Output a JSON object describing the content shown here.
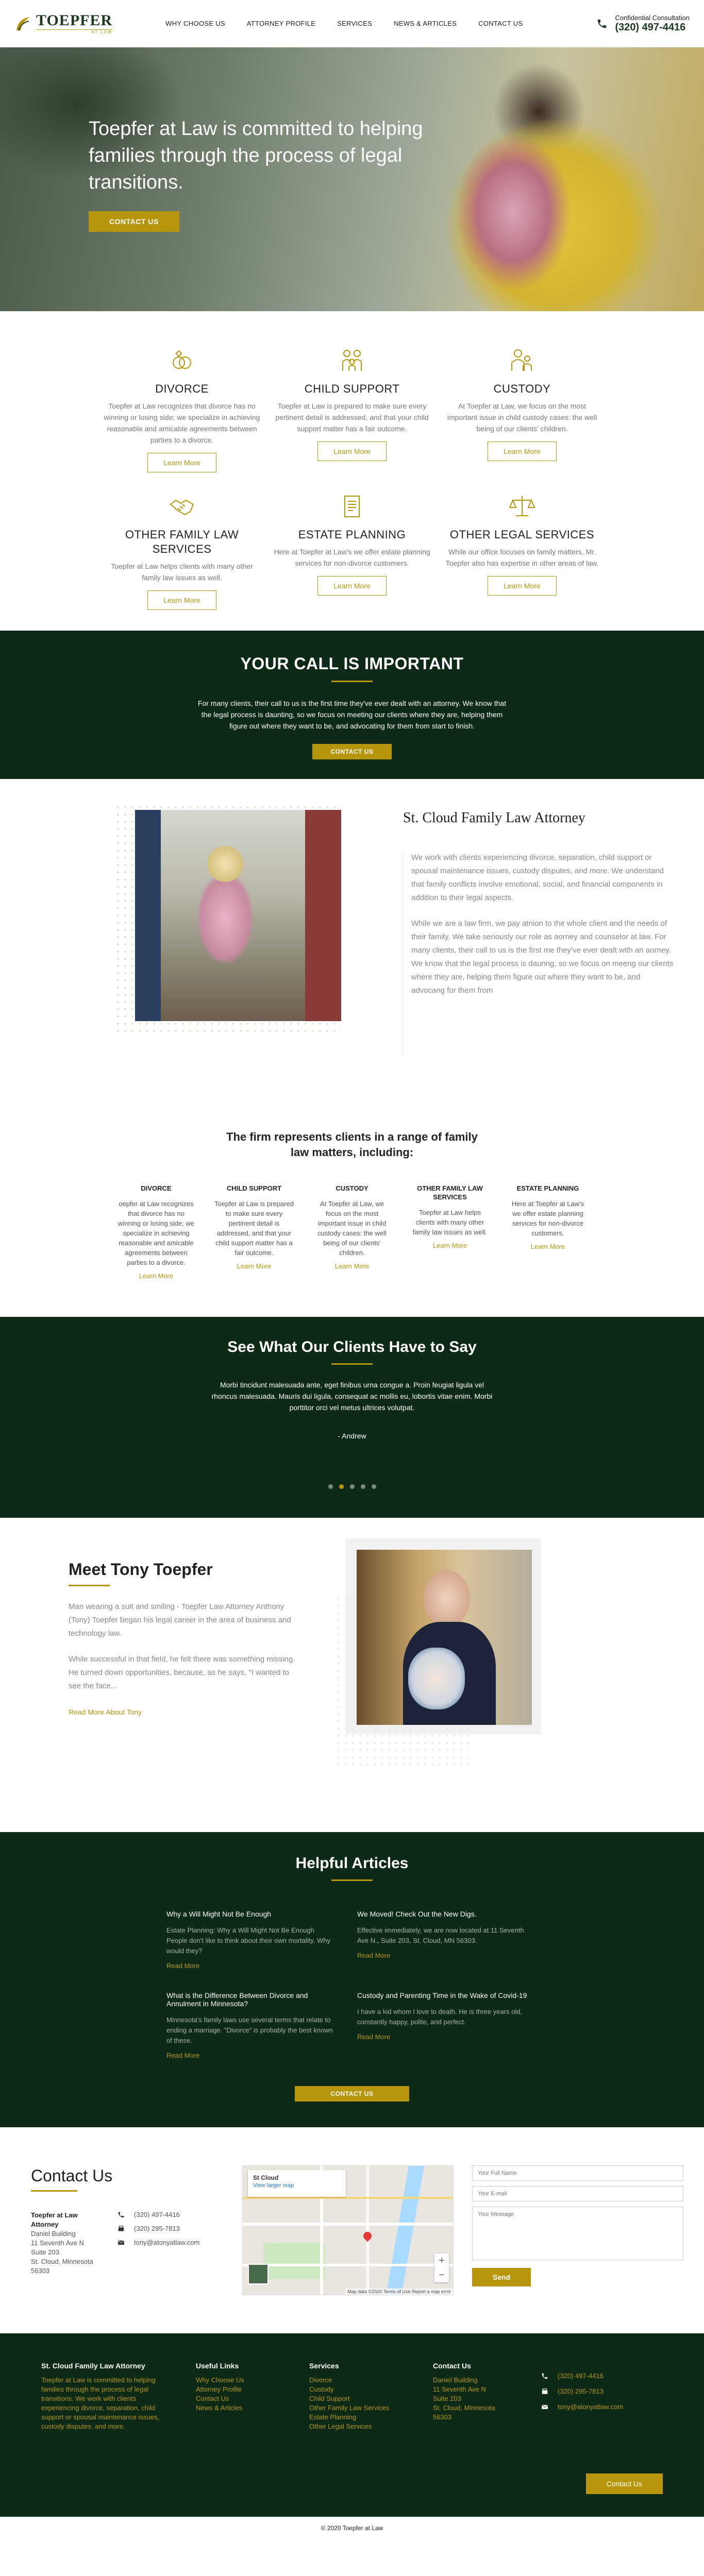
{
  "header": {
    "logo_title": "TOEPFER",
    "logo_sub": "AT LAW",
    "nav": [
      "WHY CHOOSE US",
      "ATTORNEY PROFILE",
      "SERVICES",
      "NEWS & ARTICLES",
      "CONTACT US"
    ],
    "consult_label": "Confidential Consultation",
    "consult_phone": "(320) 497-4416"
  },
  "hero": {
    "headline": "Toepfer at Law is committed to helping families through the process of legal transitions.",
    "cta": "CONTACT US"
  },
  "services": [
    {
      "title": "DIVORCE",
      "icon": "rings-icon",
      "text": "Toepfer at Law recognizes that divorce has no winning or losing side; we specialize in achieving reasonable and amicable agreements between parties to a divorce.",
      "link": "Learn More"
    },
    {
      "title": "CHILD SUPPORT",
      "icon": "family-icon",
      "text": "Toepfer at Law is prepared to make sure every pertinent detail is addressed, and that your child support matter has a fair outcome.",
      "link": "Learn More"
    },
    {
      "title": "CUSTODY",
      "icon": "parent-child-icon",
      "text": "At Toepfer at Law, we focus on the most important issue in child custody cases: the well being of our clients' children.",
      "link": "Learn More"
    },
    {
      "title": "OTHER FAMILY LAW SERVICES",
      "icon": "handshake-icon",
      "text": "Toepfer at Law helps clients with many other family law issues as well.",
      "link": "Learn More"
    },
    {
      "title": "ESTATE PLANNING",
      "icon": "document-icon",
      "text": "Here at Toepfer at Law's we offer estate planning services for non-divorce customers.",
      "link": "Learn More"
    },
    {
      "title": "OTHER LEGAL SERVICES",
      "icon": "scales-icon",
      "text": "While our office focuses on family matters, Mr. Toepfer also has expertise in other areas of law.",
      "link": "Learn More"
    }
  ],
  "call": {
    "title": "YOUR CALL IS IMPORTANT",
    "text": "For many clients, their call to us is the first time they've ever dealt with an attorney. We know that the legal process is daunting, so we focus on meeting our clients where they are, helping them figure out where they want to be, and advocating for them from start to finish.",
    "cta": "CONTACT US"
  },
  "about": {
    "title": "St. Cloud Family Law Attorney",
    "p1": "We work with clients experiencing divorce, separation, child support or spousal maintenance issues, custody disputes, and more. We understand that family conflicts involve emotional, social, and financial components in addition to their legal aspects.",
    "p2": "While we are a law firm, we pay atnion to the whole client and the needs of their family. We take seriously our role as aorney and counselor at law. For many clients, their call to us is the first me they've ever dealt with an aorney. We know that the legal process is daunng, so we focus on meeng our clients where they are, helping them figure out where they want to be, and advocang for them from"
  },
  "represent": {
    "title": "The firm represents clients in a range of family law matters, including:",
    "items": [
      {
        "title": "DIVORCE",
        "text": "oepfer at Law recognizes that divorce has no winning or losing side; we specialize in achieving reasonable and amicable agreements between parties to a divorce.",
        "link": "Learn More"
      },
      {
        "title": "CHILD SUPPORT",
        "text": "Toepfer at Law is prepared to make sure every pertinent detail is addressed, and that your child support matter has a fair outcome.",
        "link": "Learn More"
      },
      {
        "title": "CUSTODY",
        "text": "At Toepfer at Law, we focus on the most important issue in child custody cases: the well being of our clients' children.",
        "link": "Learn More"
      },
      {
        "title": "OTHER FAMILY LAW SERVICES",
        "text": "Toepfer at Law helps clients with many other family law issues as well.",
        "link": "Learn More"
      },
      {
        "title": "ESTATE PLANNING",
        "text": "Here at Toepfer at Law's we offer estate planning services for non-divorce customers.",
        "link": "Learn More"
      }
    ]
  },
  "testimonials": {
    "title": "See What Our Clients Have to Say",
    "quote": "Morbi tincidunt malesuada ante, eget finibus urna congue a. Proin feugiat ligula vel rhoncus malesuada. Mauris dui ligula, consequat ac mollis eu, lobortis vitae enim. Morbi porttitor orci vel metus ultrices volutpat.",
    "author": "- Andrew",
    "slides": 5,
    "active_slide": 1
  },
  "meet": {
    "title": "Meet Tony Toepfer",
    "p1": "Man wearing a suit and smiling - Toepfer Law Attorney Anthony (Tony) Toepfer began his legal career in the area of business and technology law.",
    "p2": "While successful in that field, he felt there was something missing. He turned down opportunities, because, as he says, \"I wanted to see the face...",
    "link": "Read More About Tony"
  },
  "articles": {
    "title": "Helpful Articles",
    "items": [
      {
        "title": "Why a Will Might Not Be Enough",
        "text": "Estate Planning: Why a Will Might Not Be Enough People don't like to think about their own mortality. Why would they?",
        "link": "Read More"
      },
      {
        "title": "We Moved! Check Out the New Digs.",
        "text": "Effective immediately, we are now located at 11 Seventh Ave N., Suite 203, St. Cloud, MN 56303.",
        "link": "Read More"
      },
      {
        "title": "What is the Difference Between Divorce and Annulment in Minnesota?",
        "text": "Minnesota's family laws use several terms that relate to ending a marriage. \"Divorce\" is probably the best known of these.",
        "link": "Read More"
      },
      {
        "title": "Custody and Parenting Time in the Wake of Covid-19",
        "text": "I have a kid whom I love to death. He is three years old, constantly happy, polite, and perfect.",
        "link": "Read More"
      }
    ],
    "cta": "CONTACT US"
  },
  "contact": {
    "title": "Contact Us",
    "firm": "Toepfer at Law Attorney",
    "address": [
      "Daniel Building",
      "11 Seventh Ave N",
      "Suite 203",
      "St. Cloud, Minnesota",
      "56303"
    ],
    "phone": "(320) 497-4416",
    "fax": "(320) 295-7813",
    "email": "tony@atonyatlaw.com",
    "map": {
      "place": "St Cloud",
      "link": "View larger map",
      "credits": "Map data ©2020   Terms of Use   Report a map error"
    },
    "form": {
      "name_ph": "Your Full Name",
      "email_ph": "Your E-mail",
      "msg_ph": "Your Message",
      "send": "Send"
    }
  },
  "footer": {
    "col1_title": "St. Cloud Family Law Attorney",
    "col1_text": "Toepfer at Law is committed to helping families through the process of legal transitions. We work with clients experiencing divorce, separation, child support or spousal maintenance issues, custody disputes, and more.",
    "links_title": "Useful Links",
    "links": [
      "Why Choose Us",
      "Attorney Profile",
      "Contact Us",
      "News & Articles"
    ],
    "services_title": "Services",
    "services": [
      "Divorce",
      "Custody",
      "Child Support",
      "Other Family Law Services",
      "Estate Planning",
      "Other Legal Services"
    ],
    "contact_title": "Contact Us",
    "contact_lines": [
      "Daniel Building",
      "11 Seventh Ave N",
      "Suite 203",
      "St. Cloud, Minnesota",
      "56303"
    ],
    "phone": "(320) 497-4416",
    "fax": "(320) 295-7813",
    "email": "tony@atonyatlaw.com",
    "cta": "Contact Us",
    "copyright": "© 2020 Toepfer at Law"
  }
}
